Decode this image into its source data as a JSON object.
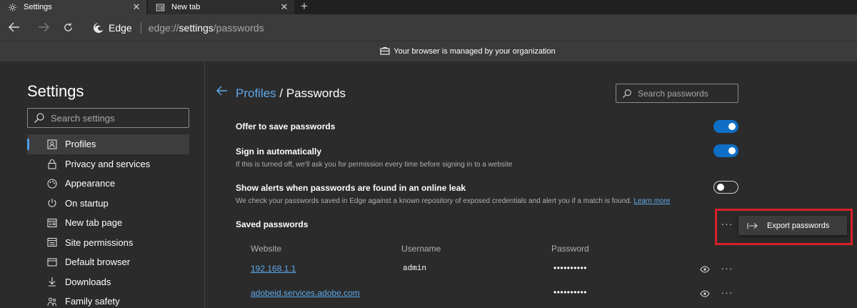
{
  "tabs": [
    {
      "title": "Settings",
      "icon": "gear-icon",
      "active": true
    },
    {
      "title": "New tab",
      "icon": "newtab-page-icon",
      "active": false
    }
  ],
  "toolbar": {
    "browser_name": "Edge",
    "url_prefix": "edge://",
    "url_host": "settings",
    "url_path": "/passwords"
  },
  "managed_bar": {
    "text": "Your browser is managed by your organization"
  },
  "sidebar": {
    "title": "Settings",
    "search_placeholder": "Search settings",
    "items": [
      {
        "label": "Profiles",
        "icon": "profile-icon",
        "active": true
      },
      {
        "label": "Privacy and services",
        "icon": "lock-icon"
      },
      {
        "label": "Appearance",
        "icon": "appearance-icon"
      },
      {
        "label": "On startup",
        "icon": "power-icon"
      },
      {
        "label": "New tab page",
        "icon": "newtab-page-icon"
      },
      {
        "label": "Site permissions",
        "icon": "site-permissions-icon"
      },
      {
        "label": "Default browser",
        "icon": "default-browser-icon"
      },
      {
        "label": "Downloads",
        "icon": "download-icon"
      },
      {
        "label": "Family safety",
        "icon": "family-icon"
      }
    ]
  },
  "main": {
    "breadcrumb_parent": "Profiles",
    "breadcrumb_sep": " / ",
    "breadcrumb_current": "Passwords",
    "search_placeholder": "Search passwords",
    "settings": [
      {
        "title": "Offer to save passwords",
        "desc": "",
        "enabled": true
      },
      {
        "title": "Sign in automatically",
        "desc": "If this is turned off, we'll ask you for permission every time before signing in to a website",
        "enabled": true
      },
      {
        "title": "Show alerts when passwords are found in an online leak",
        "desc": "We check your passwords saved in Edge against a known repository of exposed credentials and alert you if a match is found.",
        "learn_more": "Learn more",
        "enabled": false
      }
    ],
    "saved_title": "Saved passwords",
    "more_label": "···",
    "export_label": "Export passwords",
    "columns": [
      "Website",
      "Username",
      "Password"
    ],
    "rows": [
      {
        "website": "192.168.1.1",
        "username": "admin",
        "password": "••••••••••"
      },
      {
        "website": "adobeid.services.adobe.com",
        "username": "",
        "password": "••••••••••"
      }
    ]
  },
  "colors": {
    "accent": "#0f6fc6",
    "link": "#5ea9ea",
    "highlight": "#d8202a"
  }
}
